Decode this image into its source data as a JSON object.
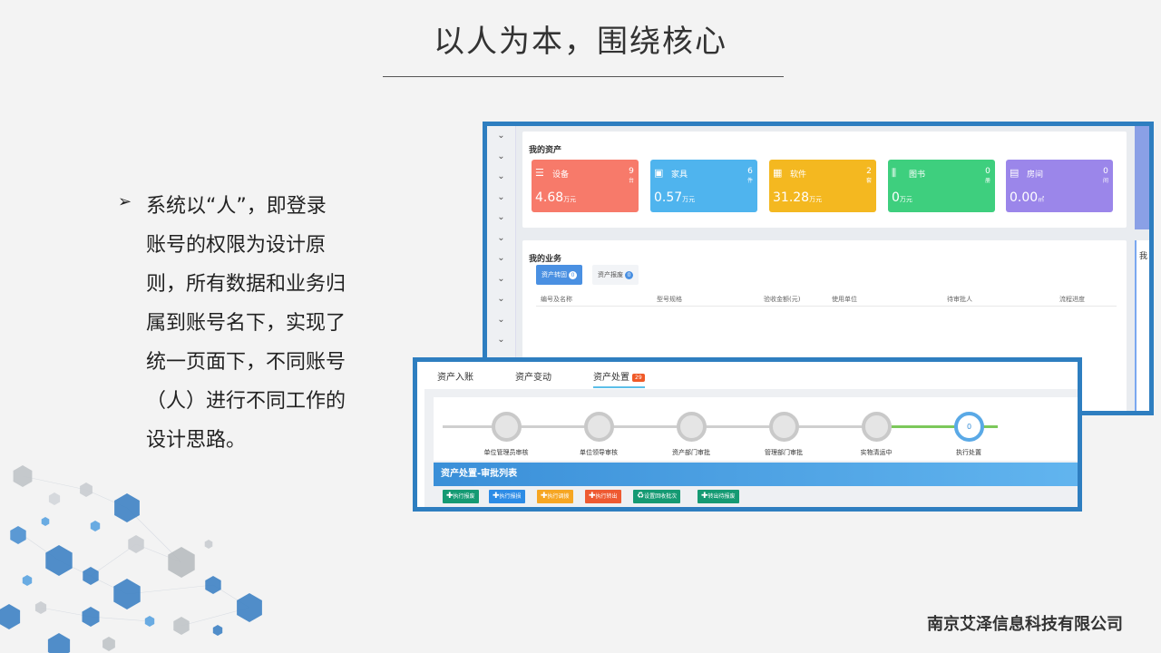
{
  "slide": {
    "title": "以人为本，围绕核心",
    "bullet_marker": "➢",
    "bullet_text": "系统以“人”，即登录账号的权限为设计原则，所有数据和业务归属到账号名下，实现了统一页面下，不同账号（人）进行不同工作的设计思路。",
    "company": "南京艾泽信息科技有限公司"
  },
  "screenshot_assets": {
    "card_title": "我的资产",
    "tiles": [
      {
        "icon": "server-icon",
        "glyph": "☰",
        "name": "设备",
        "count": "9",
        "count_unit": "台",
        "value": "4.68",
        "value_unit": "万元",
        "color": "#f77a6a"
      },
      {
        "icon": "furniture-icon",
        "glyph": "▣",
        "name": "家具",
        "count": "6",
        "count_unit": "件",
        "value": "0.57",
        "value_unit": "万元",
        "color": "#4fb4ee"
      },
      {
        "icon": "software-icon",
        "glyph": "▦",
        "name": "软件",
        "count": "2",
        "count_unit": "套",
        "value": "31.28",
        "value_unit": "万元",
        "color": "#f4b820"
      },
      {
        "icon": "books-icon",
        "glyph": "⫼",
        "name": "图书",
        "count": "0",
        "count_unit": "册",
        "value": "0",
        "value_unit": "万元",
        "color": "#3ecf7e"
      },
      {
        "icon": "building-icon",
        "glyph": "▤",
        "name": "房间",
        "count": "0",
        "count_unit": "间",
        "value": "0.00",
        "value_unit": "㎡",
        "color": "#9b86ea"
      }
    ],
    "business_title": "我的业务",
    "business_tabs": [
      {
        "label": "资产转固",
        "count": "0"
      },
      {
        "label": "资产报废",
        "count": "0"
      }
    ],
    "table_columns": [
      "编号及名称",
      "型号规格",
      "验收金额(元)",
      "使用单位",
      "待审批人",
      "流程进度"
    ],
    "right_label": "我"
  },
  "screenshot_disposal": {
    "tabs": [
      "资产入账",
      "资产变动",
      "资产处置"
    ],
    "active_badge": "29",
    "steps": [
      "单位管理员审核",
      "单位领导审核",
      "资产部门审批",
      "管理部门审批",
      "实物清运中",
      "执行处置"
    ],
    "active_step_count": "0",
    "list_header": "资产处置-审批列表",
    "buttons": [
      {
        "label": "执行报废",
        "color": "#159a73",
        "glyph": "✚"
      },
      {
        "label": "执行报损",
        "color": "#2d8ce6",
        "glyph": "✚"
      },
      {
        "label": "执行调拨",
        "color": "#f6a623",
        "glyph": "✚"
      },
      {
        "label": "执行转出",
        "color": "#ee5a32",
        "glyph": "✚"
      },
      {
        "label": "设置回收批次",
        "color": "#159a73",
        "glyph": "♻"
      },
      {
        "label": "转出待报废",
        "color": "#159a73",
        "glyph": "✚"
      }
    ]
  }
}
